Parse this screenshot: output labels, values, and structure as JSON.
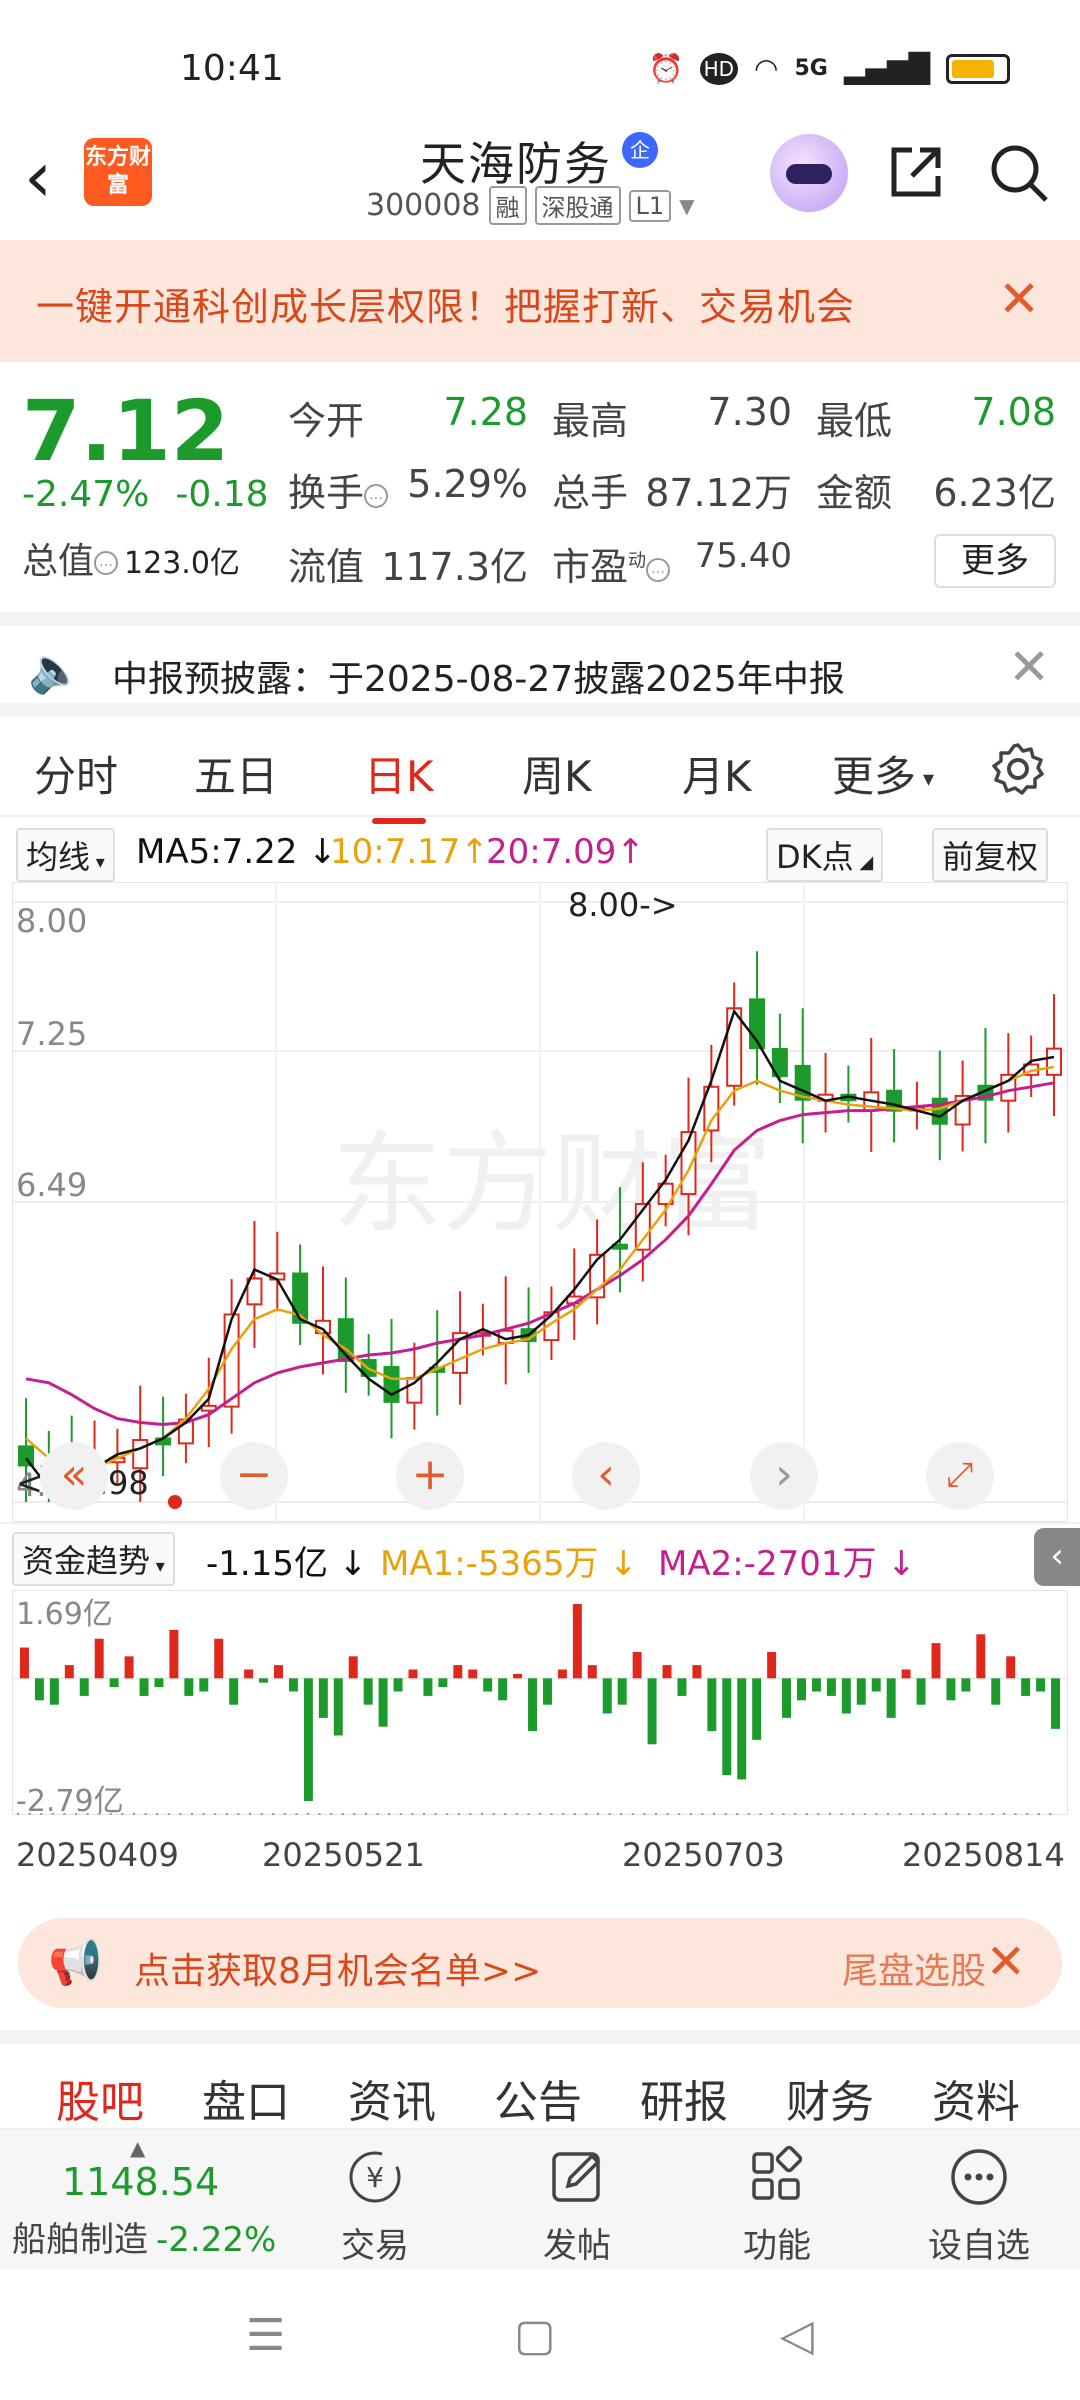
{
  "status_bar": {
    "time": "10:41",
    "hd": "HD",
    "network": "5G"
  },
  "header": {
    "logo_text": "东方财富",
    "title": "天海防务",
    "corp_badge": "企",
    "code": "300008",
    "tags": [
      "融",
      "深股通",
      "L1"
    ]
  },
  "promo_banner": {
    "text": "一键开通科创成长层权限！把握打新、交易机会"
  },
  "quote": {
    "price": "7.12",
    "change_pct": "-2.47%",
    "change_abs": "-0.18",
    "total_value_label": "总值",
    "total_value": "123.0亿",
    "open_label": "今开",
    "open": "7.28",
    "high_label": "最高",
    "high": "7.30",
    "low_label": "最低",
    "low": "7.08",
    "turnover_label": "换手",
    "turnover": "5.29%",
    "volume_label": "总手",
    "volume": "87.12万",
    "amount_label": "金额",
    "amount": "6.23亿",
    "float_label": "流值",
    "float_value": "117.3亿",
    "pe_label": "市盈",
    "pe_sup": "动",
    "pe": "75.40",
    "more": "更多"
  },
  "notice": {
    "text": "中报预披露：于2025-08-27披露2025年中报"
  },
  "period_tabs": [
    "分时",
    "五日",
    "日K",
    "周K",
    "月K",
    "更多"
  ],
  "active_period": "日K",
  "ma_legend": {
    "selector": "均线",
    "ma5": "MA5:7.22",
    "ma10": "10:7.17",
    "ma20": "20:7.09",
    "dk": "DK点",
    "adjust": "前复权"
  },
  "colors": {
    "up": "#e0271c",
    "down": "#1c9a2c",
    "ma5": "#111111",
    "ma10": "#e8a20d",
    "ma20": "#c31f8f",
    "accent": "#e0271c"
  },
  "chart_data": [
    {
      "type": "candlestick",
      "y_ticks": [
        "8.00",
        "7.25",
        "6.49",
        "4.98"
      ],
      "ylim": [
        4.98,
        8.0
      ],
      "max_marker": "8.00->",
      "min_marker": "<---4.98",
      "x_ticks": [
        "20250409",
        "20250521",
        "20250703",
        "20250814"
      ],
      "ma5_close": [
        5.2,
        5.05,
        5.12,
        5.15,
        5.22,
        5.25,
        5.3,
        5.38,
        5.5,
        5.9,
        6.15,
        6.1,
        5.9,
        5.85,
        5.72,
        5.6,
        5.52,
        5.58,
        5.68,
        5.8,
        5.85,
        5.8,
        5.82,
        5.92,
        6.05,
        6.2,
        6.3,
        6.45,
        6.6,
        6.8,
        7.1,
        7.45,
        7.3,
        7.1,
        7.05,
        7.0,
        7.02,
        7.0,
        6.98,
        6.95,
        6.92,
        7.0,
        7.05,
        7.1,
        7.2,
        7.22
      ],
      "ma10": [
        5.3,
        5.2,
        5.15,
        5.15,
        5.2,
        5.25,
        5.3,
        5.4,
        5.55,
        5.75,
        5.9,
        5.95,
        5.92,
        5.82,
        5.75,
        5.65,
        5.6,
        5.6,
        5.65,
        5.7,
        5.75,
        5.78,
        5.8,
        5.88,
        5.95,
        6.05,
        6.15,
        6.3,
        6.45,
        6.65,
        6.9,
        7.05,
        7.1,
        7.05,
        7.02,
        7.0,
        6.98,
        6.97,
        6.96,
        6.95,
        6.96,
        7.0,
        7.05,
        7.1,
        7.15,
        7.17
      ],
      "ma20": [
        5.6,
        5.58,
        5.52,
        5.45,
        5.4,
        5.38,
        5.37,
        5.38,
        5.42,
        5.5,
        5.58,
        5.63,
        5.66,
        5.68,
        5.7,
        5.72,
        5.73,
        5.75,
        5.78,
        5.8,
        5.82,
        5.85,
        5.88,
        5.93,
        5.98,
        6.05,
        6.12,
        6.2,
        6.3,
        6.42,
        6.58,
        6.75,
        6.85,
        6.9,
        6.93,
        6.94,
        6.95,
        6.95,
        6.96,
        6.97,
        6.98,
        7.0,
        7.02,
        7.05,
        7.07,
        7.09
      ],
      "closing_price": "7.12"
    },
    {
      "type": "bar",
      "title": "资金趋势",
      "value": "-1.15亿",
      "ma1": "MA1:-5365万",
      "ma2": "MA2:-2701万",
      "y_ticks": [
        "1.69亿",
        "-2.79亿"
      ],
      "ylim": [
        -2.79,
        1.69
      ],
      "values": [
        0.7,
        -0.5,
        -0.6,
        0.3,
        -0.4,
        0.9,
        -0.2,
        0.5,
        -0.4,
        -0.2,
        1.1,
        -0.4,
        -0.3,
        0.9,
        -0.6,
        0.2,
        -0.1,
        0.3,
        -0.3,
        -2.79,
        -0.9,
        -1.3,
        0.5,
        -0.6,
        -1.1,
        -0.3,
        0.2,
        -0.4,
        -0.2,
        0.3,
        0.2,
        -0.3,
        -0.5,
        0.1,
        -1.2,
        -0.6,
        0.2,
        1.69,
        0.3,
        -0.8,
        -0.6,
        0.6,
        -1.5,
        0.3,
        -0.4,
        0.3,
        -1.2,
        -2.2,
        -2.3,
        -1.4,
        0.6,
        -0.9,
        -0.5,
        -0.3,
        -0.4,
        -0.8,
        -0.6,
        -0.3,
        -0.9,
        0.2,
        -0.6,
        0.8,
        -0.5,
        -0.3,
        1.0,
        -0.6,
        0.5,
        -0.4,
        -0.3,
        -1.15
      ]
    }
  ],
  "promo2": {
    "text": "点击获取8月机会名单>>",
    "text2": "尾盘选股"
  },
  "bottom_tabs": [
    "股吧",
    "盘口",
    "资讯",
    "公告",
    "研报",
    "财务",
    "资料"
  ],
  "active_bottom_tab": "股吧",
  "toolbar": {
    "index_value": "1148.54",
    "index_name": "船舶制造",
    "index_change": "-2.22%",
    "buttons": [
      "交易",
      "发帖",
      "功能",
      "设自选"
    ]
  }
}
